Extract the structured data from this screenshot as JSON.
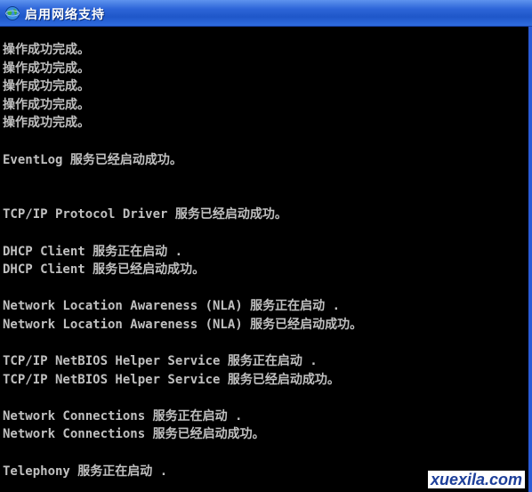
{
  "window": {
    "title": "启用网络支持",
    "icon": "network-globe-icon"
  },
  "console": {
    "lines": [
      "操作成功完成。",
      "操作成功完成。",
      "操作成功完成。",
      "操作成功完成。",
      "操作成功完成。",
      "",
      "EventLog 服务已经启动成功。",
      "",
      "",
      "TCP/IP Protocol Driver 服务已经启动成功。",
      "",
      "DHCP Client 服务正在启动 .",
      "DHCP Client 服务已经启动成功。",
      "",
      "Network Location Awareness (NLA) 服务正在启动 .",
      "Network Location Awareness (NLA) 服务已经启动成功。",
      "",
      "TCP/IP NetBIOS Helper Service 服务正在启动 .",
      "TCP/IP NetBIOS Helper Service 服务已经启动成功。",
      "",
      "Network Connections 服务正在启动 .",
      "Network Connections 服务已经启动成功。",
      "",
      "Telephony 服务正在启动 ."
    ]
  },
  "watermark": "xuexila.com",
  "colors": {
    "titlebar": "#2d65d8",
    "console_bg": "#000000",
    "console_text": "#c0c0c0"
  }
}
